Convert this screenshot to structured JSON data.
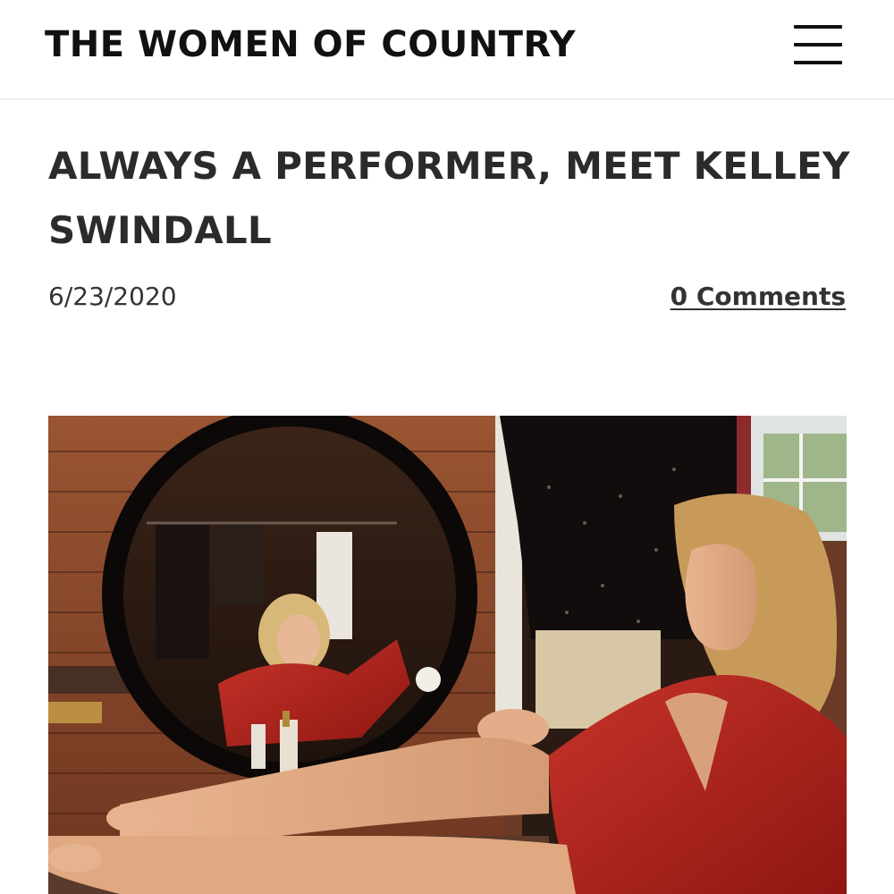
{
  "header": {
    "site_title": "THE WOMEN OF COUNTRY",
    "menu_icon": "hamburger-menu-icon"
  },
  "post": {
    "title": "ALWAYS A PERFORMER, MEET KELLEY SWINDALL",
    "date": "6/23/2020",
    "comments_label": "0 Comments"
  },
  "photo": {
    "subject": "woman in red robe seated before round mirror"
  },
  "colors": {
    "text_dark": "#111111",
    "title_gray": "#2b2b2b",
    "robe_red": "#b0221c",
    "brick": "#8a4a2c"
  }
}
